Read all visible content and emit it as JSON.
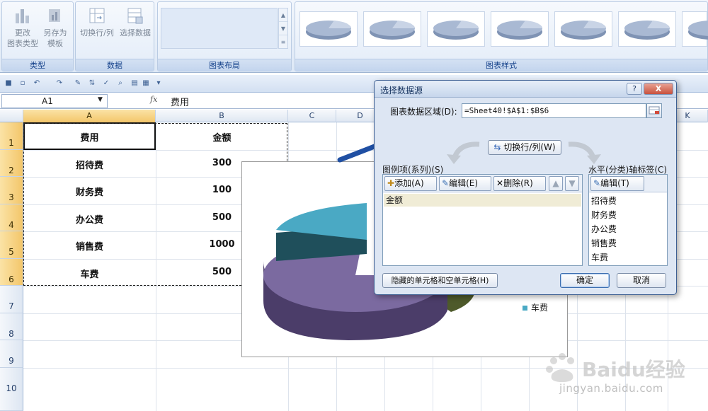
{
  "ribbon": {
    "groups": [
      {
        "label": "类型",
        "buttons": [
          "更改\n图表类型",
          "另存为\n模板"
        ]
      },
      {
        "label": "数据",
        "buttons": [
          "切换行/列",
          "选择数据"
        ]
      },
      {
        "label": "图表布局"
      },
      {
        "label": "图表样式"
      }
    ],
    "type_change_line1": "更改",
    "type_change_line2": "图表类型",
    "save_template_line1": "另存为",
    "save_template_line2": "模板",
    "switch_label": "切换行/列",
    "select_data_label": "选择数据",
    "group_type": "类型",
    "group_data": "数据",
    "group_layout": "图表布局",
    "group_styles": "图表样式"
  },
  "formula_bar": {
    "name_box": "A1",
    "fx": "fx",
    "content": "费用"
  },
  "sheet": {
    "columns": [
      "A",
      "B",
      "C",
      "D",
      "K"
    ],
    "rows": [
      "1",
      "2",
      "3",
      "4",
      "5",
      "6",
      "7",
      "8",
      "9",
      "10"
    ],
    "table": [
      [
        "费用",
        "金额"
      ],
      [
        "招待费",
        "300"
      ],
      [
        "财务费",
        "100"
      ],
      [
        "办公费",
        "500"
      ],
      [
        "销售费",
        "1000"
      ],
      [
        "车费",
        "500"
      ]
    ]
  },
  "chart": {
    "legend_visible_entry": "车费",
    "colors": {
      "purple": "#7b6aa0",
      "teal": "#4aa9c4",
      "olive": "#4e5a2b"
    }
  },
  "dialog": {
    "title": "选择数据源",
    "help": "?",
    "close": "X",
    "range_label": "图表数据区域(D):",
    "range_value": "=Sheet40!$A$1:$B$6",
    "switch_button": "切换行/列(W)",
    "legend_label": "图例项(系列)(S)",
    "add_button": "添加(A)",
    "edit_button": "编辑(E)",
    "delete_button": "删除(R)",
    "series": [
      "金额"
    ],
    "axis_label": "水平(分类)轴标签(C)",
    "axis_edit_button": "编辑(T)",
    "axis_items": [
      "招待费",
      "财务费",
      "办公费",
      "销售费",
      "车费"
    ],
    "hidden_cells_button": "隐藏的单元格和空单元格(H)",
    "ok": "确定",
    "cancel": "取消"
  },
  "watermark": {
    "brand": "Baidu经验",
    "url": "jingyan.baidu.com"
  }
}
